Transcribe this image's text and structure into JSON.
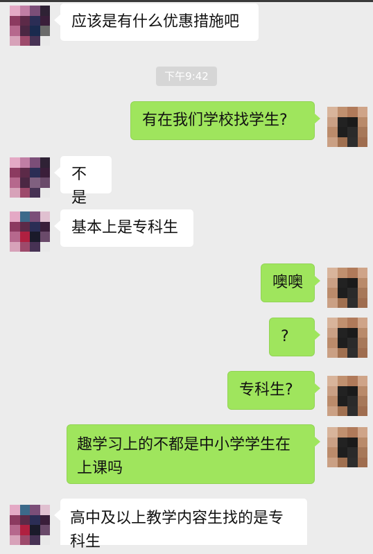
{
  "status_bar": {},
  "timestamp": "下午9:42",
  "messages": [
    {
      "side": "in",
      "text": "应该是有什么优惠措施吧"
    },
    {
      "side": "out",
      "text": "有在我们学校找学生?"
    },
    {
      "side": "in",
      "text": "不是"
    },
    {
      "side": "in",
      "text": "基本上是专科生"
    },
    {
      "side": "out",
      "text": "噢噢"
    },
    {
      "side": "out",
      "text": "?"
    },
    {
      "side": "out",
      "text": "专科生?"
    },
    {
      "side": "out",
      "text": "趣学习上的不都是中小学学生在上课吗"
    },
    {
      "side": "in",
      "text": "高中及以上教学内容生找的是专科生"
    }
  ],
  "colors": {
    "background": "#ececec",
    "incoming_bubble": "#ffffff",
    "outgoing_bubble": "#9fe55d"
  },
  "avatars": {
    "contact": "pixelated-avatar-icon",
    "self": "pixelated-avatar-icon"
  }
}
